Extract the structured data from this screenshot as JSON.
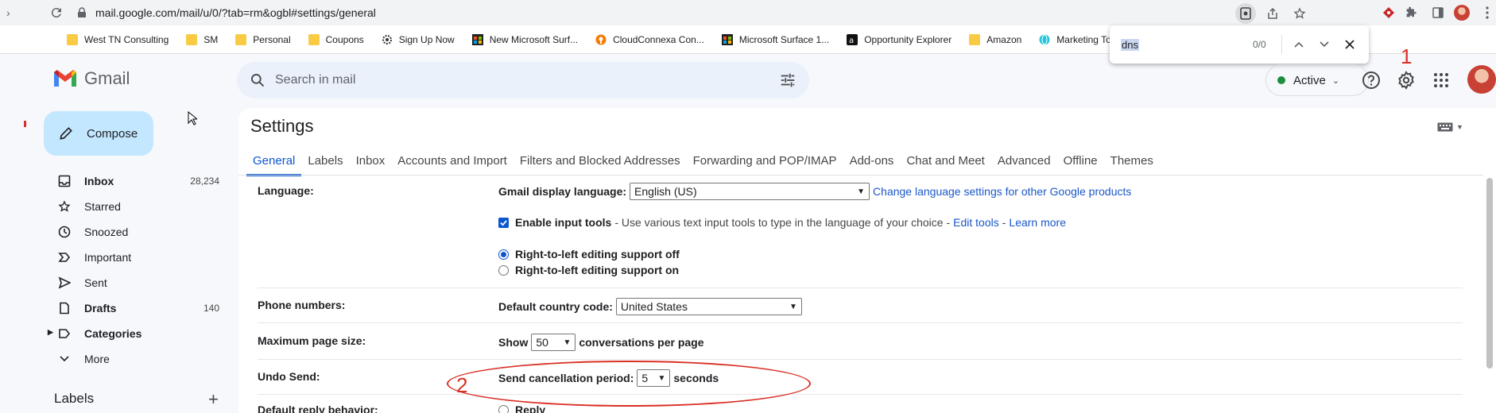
{
  "browser": {
    "url": "mail.google.com/mail/u/0/?tab=rm&ogbl#settings/general",
    "bookmarks": [
      {
        "label": "West TN Consulting",
        "icon": "folder-icon"
      },
      {
        "label": "SM",
        "icon": "folder-icon"
      },
      {
        "label": "Personal",
        "icon": "folder-icon"
      },
      {
        "label": "Coupons",
        "icon": "folder-icon"
      },
      {
        "label": "Sign Up Now",
        "icon": "gear-badge-icon"
      },
      {
        "label": "New Microsoft Surf...",
        "icon": "microsoft-icon"
      },
      {
        "label": "CloudConnexa Con...",
        "icon": "cloudconnexa-icon"
      },
      {
        "label": "Microsoft Surface 1...",
        "icon": "microsoft-icon"
      },
      {
        "label": "Opportunity Explorer",
        "icon": "amazon-icon"
      },
      {
        "label": "Amazon",
        "icon": "folder-icon"
      },
      {
        "label": "Marketing Tools",
        "icon": "globe-icon"
      }
    ],
    "find": {
      "query": "dns",
      "count": "0/0"
    }
  },
  "gmail": {
    "app_name": "Gmail",
    "search_placeholder": "Search in mail",
    "status": "Active",
    "annotation_1": "1",
    "annotation_2": "2"
  },
  "sidebar": {
    "compose_label": "Compose",
    "items": [
      {
        "label": "Inbox",
        "count": "28,234",
        "icon": "inbox-icon"
      },
      {
        "label": "Starred",
        "count": "",
        "icon": "star-icon"
      },
      {
        "label": "Snoozed",
        "count": "",
        "icon": "clock-icon"
      },
      {
        "label": "Important",
        "count": "",
        "icon": "important-icon"
      },
      {
        "label": "Sent",
        "count": "",
        "icon": "send-icon"
      },
      {
        "label": "Drafts",
        "count": "140",
        "icon": "draft-icon"
      },
      {
        "label": "Categories",
        "count": "",
        "icon": "label-icon"
      },
      {
        "label": "More",
        "count": "",
        "icon": "chevron-down-icon"
      }
    ],
    "labels_header": "Labels"
  },
  "settings": {
    "title": "Settings",
    "tabs": [
      "General",
      "Labels",
      "Inbox",
      "Accounts and Import",
      "Filters and Blocked Addresses",
      "Forwarding and POP/IMAP",
      "Add-ons",
      "Chat and Meet",
      "Advanced",
      "Offline",
      "Themes"
    ],
    "language": {
      "label": "Language:",
      "display_label": "Gmail display language:",
      "display_value": "English (US)",
      "change_link": "Change language settings for other Google products",
      "input_tools_label": "Enable input tools",
      "input_tools_desc": "- Use various text input tools to type in the language of your choice -",
      "edit_tools": "Edit tools",
      "dash": "-",
      "learn_more": "Learn more",
      "rtl_off": "Right-to-left editing support off",
      "rtl_on": "Right-to-left editing support on"
    },
    "phone": {
      "label": "Phone numbers:",
      "country_label": "Default country code:",
      "country_value": "United States"
    },
    "page_size": {
      "label": "Maximum page size:",
      "show": "Show",
      "value": "50",
      "suffix": "conversations per page"
    },
    "undo": {
      "label": "Undo Send:",
      "period_label": "Send cancellation period:",
      "value": "5",
      "suffix": "seconds"
    },
    "reply": {
      "label": "Default reply behavior:",
      "option": "Reply"
    }
  }
}
